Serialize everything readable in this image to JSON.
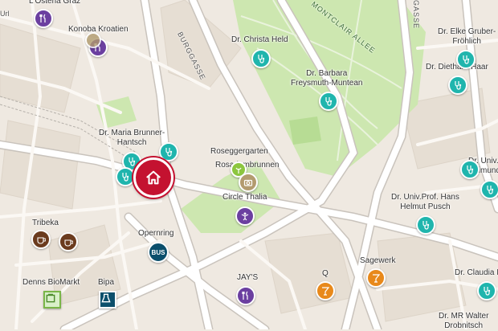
{
  "map": {
    "streets": [
      "BURGGASSE",
      "MONTCLAIR ALLEE",
      "GASSE",
      "Url"
    ],
    "places": {
      "osteria": "L'Osteria Graz",
      "konoba": "Konoba Kroatien",
      "christa": "Dr. Christa Held",
      "barbara": "Dr. Barbara\nFreysmuth-Muntean",
      "elke": "Dr. Elke Gruber-\nFröhlich",
      "diethard": "Dr. Diethard Haar",
      "maria": "Dr. Maria Brunner-\nHantsch",
      "rosegger": "Roseggergarten",
      "rosarium": "Rosariumbrunnen",
      "thalia": "Circle Thalia",
      "univ_raimund": "Dr. Univ.\nRaimund W",
      "hans": "Dr. Univ.Prof. Hans\nHelmut Pusch",
      "tribeka": "Tribeka",
      "opernring": "Opernring",
      "denns": "Denns BioMarkt",
      "bipa": "Bipa",
      "jays": "JAY'S",
      "q": "Q",
      "sagewerk": "Sagewerk",
      "claudia": "Dr. Claudia I",
      "walter": "Dr. MR Walter\nDrobnitsch"
    },
    "icons": {
      "restaurant": "fork-knife-icon",
      "doctor": "stethoscope-icon",
      "home": "home-icon",
      "cafe": "coffee-cup-icon",
      "bus": "BUS",
      "bar": "cocktail-icon",
      "camera": "camera-icon",
      "theatre": "theatre-icon"
    },
    "colors": {
      "restaurant": "#6b3fa0",
      "doctor": "#1fb5ad",
      "home": "#c41230",
      "cafe": "#6b3b1e",
      "bar": "#e8891b",
      "park": "#cde7b0",
      "road": "#ffffff"
    }
  }
}
